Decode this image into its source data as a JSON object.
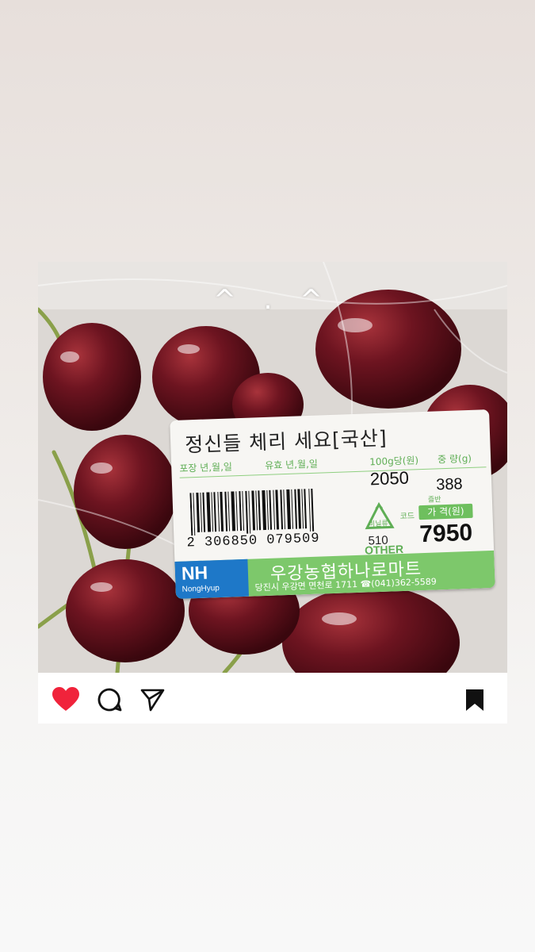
{
  "post": {
    "overlay_emoticon": "^ . ^"
  },
  "price_label": {
    "title": "정신들 체리 세요[국산]",
    "headers": [
      "포장 년,월,일",
      "유효 년,월,일",
      "100g당(원)",
      "중 량(g)"
    ],
    "unit_price": "2050",
    "weight": "388",
    "weight_sub": "즐반",
    "barcode_number": "2 306850 079509",
    "recycle_top": "비닐류",
    "recycle_number": "510",
    "recycle_other": "OTHER",
    "code_label": "코드",
    "price_header": "가 격(원)",
    "price": "7950",
    "brand_logo": "NH",
    "brand_sub": "NongHyup",
    "store_name": "우강농협하나로마트",
    "store_address": "당진시 우강면 면천로 1711 ☎(041)362-5589"
  },
  "actions": {
    "like_icon": "heart-icon",
    "comment_icon": "comment-icon",
    "share_icon": "send-icon",
    "save_icon": "bookmark-icon",
    "like_color": "#f0233b"
  }
}
